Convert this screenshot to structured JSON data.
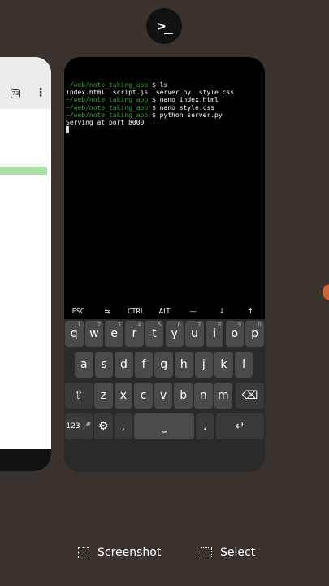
{
  "app_icon": {
    "glyph": ">_",
    "name": "termux-app-icon"
  },
  "left_card": {
    "tab_count": "73",
    "menu_glyph": "⋮"
  },
  "terminal": {
    "lines": [
      {
        "path": "~/web/note_taking_app",
        "cmd": " $ ls"
      },
      {
        "text": "index.html  script.js  server.py  style.css"
      },
      {
        "path": "~/web/note_taking_app",
        "cmd": " $ nano index.html"
      },
      {
        "path": "~/web/note_taking_app",
        "cmd": " $ nano style.css"
      },
      {
        "path": "~/web/note_taking_app",
        "cmd": " $ python server.py"
      },
      {
        "text": "Serving at port 8000"
      }
    ]
  },
  "extra_keys": [
    "ESC",
    "⇆",
    "CTRL",
    "ALT",
    "—",
    "↓",
    "↑"
  ],
  "keyboard": {
    "row1": [
      {
        "k": "q",
        "s": "1"
      },
      {
        "k": "w",
        "s": "2"
      },
      {
        "k": "e",
        "s": "3"
      },
      {
        "k": "r",
        "s": "4"
      },
      {
        "k": "t",
        "s": "5"
      },
      {
        "k": "y",
        "s": "6"
      },
      {
        "k": "u",
        "s": "7"
      },
      {
        "k": "i",
        "s": "8"
      },
      {
        "k": "o",
        "s": "9"
      },
      {
        "k": "p",
        "s": "0"
      }
    ],
    "row2": [
      "a",
      "s",
      "d",
      "f",
      "g",
      "h",
      "j",
      "k",
      "l"
    ],
    "row3": [
      "z",
      "x",
      "c",
      "v",
      "b",
      "n",
      "m"
    ],
    "shift": "⇧",
    "backspace": "⌫",
    "num": "123",
    "mic": "🎤",
    "emoji": "⚙",
    "comma": ",",
    "space": "⎵",
    "period": ".",
    "enter": "↵"
  },
  "actions": {
    "screenshot": "Screenshot",
    "select": "Select"
  }
}
